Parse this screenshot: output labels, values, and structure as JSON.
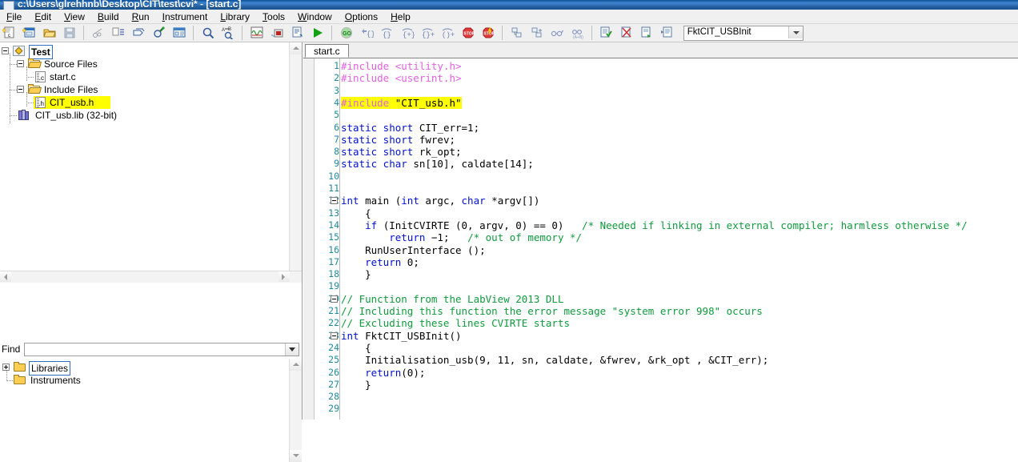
{
  "window": {
    "title": "c:\\Users\\glrehhnb\\Desktop\\CIT\\test\\cvi* - [start.c]"
  },
  "menu": [
    {
      "label": "File",
      "accel": "F"
    },
    {
      "label": "Edit",
      "accel": "E"
    },
    {
      "label": "View",
      "accel": "V"
    },
    {
      "label": "Build",
      "accel": "B"
    },
    {
      "label": "Run",
      "accel": "R"
    },
    {
      "label": "Instrument",
      "accel": "I"
    },
    {
      "label": "Library",
      "accel": "L"
    },
    {
      "label": "Tools",
      "accel": "T"
    },
    {
      "label": "Window",
      "accel": "W"
    },
    {
      "label": "Options",
      "accel": "O"
    },
    {
      "label": "Help",
      "accel": "H"
    }
  ],
  "toolbar": {
    "function_combo_value": "FktCIT_USBInit",
    "icons": [
      "new-source-file-icon",
      "new-ui-file-icon",
      "open-file-icon",
      "save-file-icon",
      "cut-icon",
      "indent-icon",
      "paste-icon",
      "find-icon",
      "view-panel-icon",
      "zoom-icon",
      "find-replace-icon",
      "graph-icon",
      "array-display-icon",
      "source-window-icon",
      "run-icon",
      "go-icon",
      "step-into-icon",
      "step-over-icon",
      "step-out-icon",
      "continue-icon",
      "finish-function-icon",
      "terminate-icon",
      "terminate-all-icon",
      "breakpoint-icon",
      "breakpoint-clear-icon",
      "watch-icon",
      "watch-expr-icon",
      "build-icon",
      "build-cancel-icon",
      "build-run-icon",
      "build-all-icon"
    ]
  },
  "project_tree": {
    "root": {
      "label": "Test",
      "icon": "project-icon",
      "expanded": true,
      "selected": true
    },
    "groups": [
      {
        "label": "Source Files",
        "icon": "folder-open-icon",
        "expanded": true,
        "children": [
          {
            "label": "start.c",
            "icon": "c-file-icon",
            "highlighted": false
          }
        ]
      },
      {
        "label": "Include Files",
        "icon": "folder-open-icon",
        "expanded": true,
        "children": [
          {
            "label": "CIT_usb.h",
            "icon": "h-file-icon",
            "highlighted": true
          }
        ]
      }
    ],
    "extra": [
      {
        "label": "CIT_usb.lib (32-bit)",
        "icon": "library-icon",
        "highlighted": false
      }
    ]
  },
  "find": {
    "label": "Find",
    "value": "",
    "placeholder": ""
  },
  "library_tree": [
    {
      "label": "Libraries",
      "icon": "folder-icon",
      "expandable": true,
      "selected": true
    },
    {
      "label": "Instruments",
      "icon": "folder-icon",
      "expandable": false,
      "selected": false
    }
  ],
  "editor": {
    "tabs": [
      {
        "label": "start.c",
        "active": true
      }
    ],
    "first_line": 1,
    "last_line": 29,
    "lines": [
      {
        "n": 1,
        "fold": false,
        "segments": [
          {
            "t": "#include ",
            "c": "pp"
          },
          {
            "t": "<utility.h>",
            "c": "pp"
          }
        ]
      },
      {
        "n": 2,
        "fold": false,
        "segments": [
          {
            "t": "#include ",
            "c": "pp"
          },
          {
            "t": "<userint.h>",
            "c": "pp"
          }
        ]
      },
      {
        "n": 3,
        "fold": false,
        "segments": []
      },
      {
        "n": 4,
        "fold": false,
        "hl": true,
        "segments": [
          {
            "t": "#include ",
            "c": "pp"
          },
          {
            "t": "\"CIT_usb.h\"",
            "c": "tx"
          }
        ]
      },
      {
        "n": 5,
        "fold": false,
        "segments": []
      },
      {
        "n": 6,
        "fold": false,
        "segments": [
          {
            "t": "static short ",
            "c": "kw"
          },
          {
            "t": "CIT_err=1;",
            "c": "tx"
          }
        ]
      },
      {
        "n": 7,
        "fold": false,
        "segments": [
          {
            "t": "static short ",
            "c": "kw"
          },
          {
            "t": "fwrev;",
            "c": "tx"
          }
        ]
      },
      {
        "n": 8,
        "fold": false,
        "segments": [
          {
            "t": "static short ",
            "c": "kw"
          },
          {
            "t": "rk_opt;",
            "c": "tx"
          }
        ]
      },
      {
        "n": 9,
        "fold": false,
        "segments": [
          {
            "t": "static char ",
            "c": "kw"
          },
          {
            "t": "sn[10], caldate[14];",
            "c": "tx"
          }
        ]
      },
      {
        "n": 10,
        "fold": false,
        "segments": []
      },
      {
        "n": 11,
        "fold": false,
        "segments": []
      },
      {
        "n": 12,
        "fold": true,
        "segments": [
          {
            "t": "int ",
            "c": "kw"
          },
          {
            "t": "main (",
            "c": "tx"
          },
          {
            "t": "int ",
            "c": "kw"
          },
          {
            "t": "argc, ",
            "c": "tx"
          },
          {
            "t": "char ",
            "c": "kw"
          },
          {
            "t": "*argv[])",
            "c": "tx"
          }
        ]
      },
      {
        "n": 13,
        "fold": false,
        "segments": [
          {
            "t": "    {",
            "c": "tx"
          }
        ]
      },
      {
        "n": 14,
        "fold": false,
        "segments": [
          {
            "t": "    ",
            "c": "tx"
          },
          {
            "t": "if ",
            "c": "kw"
          },
          {
            "t": "(InitCVIRTE (0, argv, 0) == 0)   ",
            "c": "tx"
          },
          {
            "t": "/* Needed if linking in external compiler; harmless otherwise */",
            "c": "cm"
          }
        ]
      },
      {
        "n": 15,
        "fold": false,
        "segments": [
          {
            "t": "        ",
            "c": "tx"
          },
          {
            "t": "return ",
            "c": "kw"
          },
          {
            "t": "−1;   ",
            "c": "tx"
          },
          {
            "t": "/* out of memory */",
            "c": "cm"
          }
        ]
      },
      {
        "n": 16,
        "fold": false,
        "segments": [
          {
            "t": "    RunUserInterface ();",
            "c": "tx"
          }
        ]
      },
      {
        "n": 17,
        "fold": false,
        "segments": [
          {
            "t": "    ",
            "c": "tx"
          },
          {
            "t": "return ",
            "c": "kw"
          },
          {
            "t": "0;",
            "c": "tx"
          }
        ]
      },
      {
        "n": 18,
        "fold": false,
        "segments": [
          {
            "t": "    }",
            "c": "tx"
          }
        ]
      },
      {
        "n": 19,
        "fold": false,
        "segments": []
      },
      {
        "n": 20,
        "fold": true,
        "segments": [
          {
            "t": "// Function from the LabView 2013 DLL",
            "c": "cm"
          }
        ]
      },
      {
        "n": 21,
        "fold": false,
        "segments": [
          {
            "t": "// Including this function the error message \"system error 998\" occurs",
            "c": "cm"
          }
        ]
      },
      {
        "n": 22,
        "fold": false,
        "segments": [
          {
            "t": "// Excluding these lines CVIRTE starts",
            "c": "cm"
          }
        ]
      },
      {
        "n": 23,
        "fold": true,
        "segments": [
          {
            "t": "int ",
            "c": "kw"
          },
          {
            "t": "FktCIT_USBInit()",
            "c": "tx"
          }
        ]
      },
      {
        "n": 24,
        "fold": false,
        "segments": [
          {
            "t": "    {",
            "c": "tx"
          }
        ]
      },
      {
        "n": 25,
        "fold": false,
        "segments": [
          {
            "t": "    Initialisation_usb(9, 11, sn, caldate, &fwrev, &rk_opt , &CIT_err);",
            "c": "tx"
          }
        ]
      },
      {
        "n": 26,
        "fold": false,
        "segments": [
          {
            "t": "    ",
            "c": "tx"
          },
          {
            "t": "return",
            "c": "kw"
          },
          {
            "t": "(0);",
            "c": "tx"
          }
        ]
      },
      {
        "n": 27,
        "fold": false,
        "segments": [
          {
            "t": "    }",
            "c": "tx"
          }
        ]
      },
      {
        "n": 28,
        "fold": false,
        "segments": []
      },
      {
        "n": 29,
        "fold": false,
        "segments": []
      }
    ]
  },
  "colors": {
    "keyword": "#0010d0",
    "preprocessor": "#e060e0",
    "comment": "#0f9a3c",
    "linenumber": "#1f8a9c",
    "highlight": "#ffff00",
    "titlebar": "#1f5fa8",
    "chrome": "#f0f0f0"
  }
}
